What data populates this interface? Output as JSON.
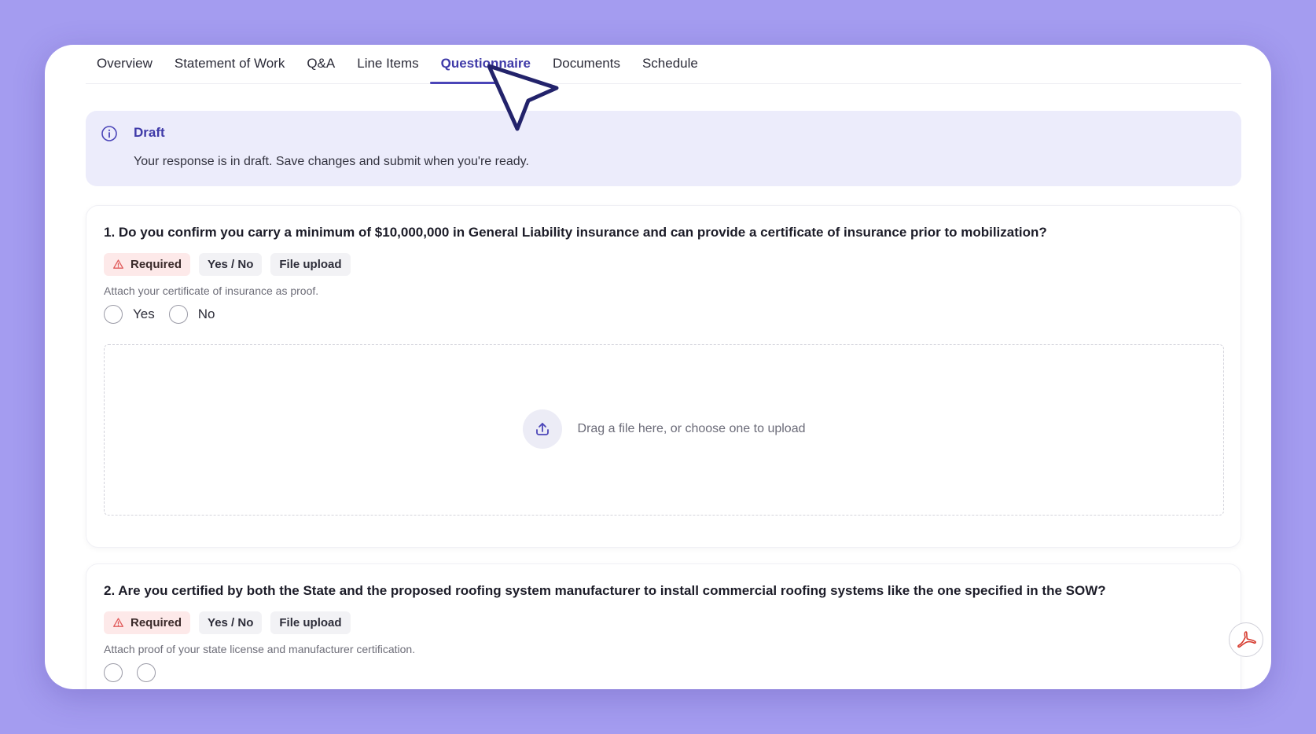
{
  "tabs": [
    {
      "label": "Overview"
    },
    {
      "label": "Statement of Work"
    },
    {
      "label": "Q&A"
    },
    {
      "label": "Line Items"
    },
    {
      "label": "Questionnaire"
    },
    {
      "label": "Documents"
    },
    {
      "label": "Schedule"
    }
  ],
  "active_tab": "Questionnaire",
  "banner": {
    "icon": "info-icon",
    "title": "Draft",
    "text": "Your response is in draft. Save changes and submit when you're ready."
  },
  "questions": [
    {
      "text": "1. Do you confirm you carry a minimum of $10,000,000 in General Liability insurance and can provide a certificate of insurance prior to mobilization?",
      "chips": [
        "Required",
        "Yes / No",
        "File upload"
      ],
      "hint": "Attach your certificate of insurance as proof.",
      "options": [
        "Yes",
        "No"
      ],
      "upload_text": "Drag a file here, or choose one to upload"
    },
    {
      "text": "2. Are you certified by both the State and the proposed roofing system manufacturer to install commercial roofing systems like the one specified in the SOW?",
      "chips": [
        "Required",
        "Yes / No",
        "File upload"
      ],
      "hint": "Attach proof of your state license and manufacturer certification."
    }
  ],
  "colors": {
    "background": "#a49cf0",
    "accent": "#4b45b8",
    "banner_bg": "#ececfb",
    "required_bg": "#fde9e9",
    "required_icon": "#e05a5a"
  },
  "icons": {
    "upload": "upload-icon",
    "warning": "warning-icon",
    "pdf": "pdf-icon",
    "cursor": "cursor-pointer-icon"
  }
}
